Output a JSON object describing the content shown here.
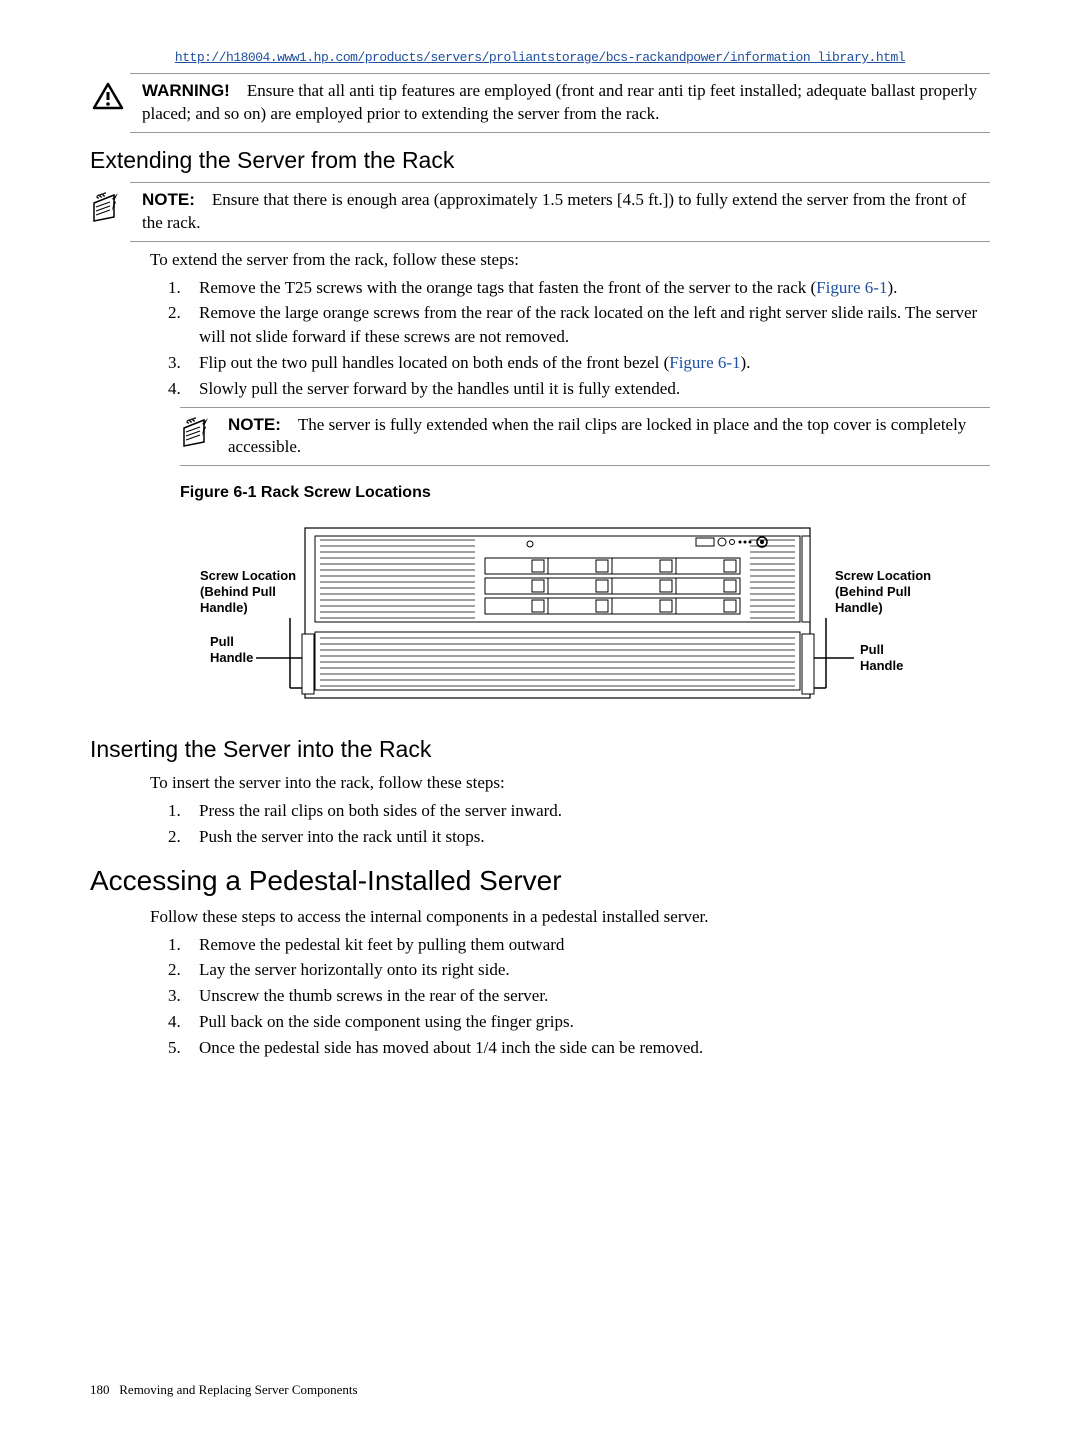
{
  "url": "http://h18004.www1.hp.com/products/servers/proliantstorage/bcs-rackandpower/information_library.html",
  "warning": {
    "label": "WARNING!",
    "text": "Ensure that all anti tip features are employed (front and rear anti tip feet installed; adequate ballast properly placed; and so on) are employed prior to extending the server from the rack."
  },
  "section1": {
    "heading": "Extending the Server from the Rack",
    "note1": {
      "label": "NOTE:",
      "text": "Ensure that there is enough area (approximately 1.5 meters [4.5 ft.]) to fully extend the server from the front of the rack."
    },
    "intro": "To extend the server from the rack, follow these steps:",
    "steps": {
      "s1_a": "Remove the T25 screws with the orange tags that fasten the front of the server to the rack (",
      "s1_link": "Figure 6-1",
      "s1_b": ").",
      "s2": "Remove the large orange screws from the rear of the rack located on the left and right server slide rails. The server will not slide forward if these screws are not removed.",
      "s3_a": "Flip out the two pull handles located on both ends of the front bezel (",
      "s3_link": "Figure 6-1",
      "s3_b": ").",
      "s4": "Slowly pull the server forward by the handles until it is fully extended."
    },
    "note2": {
      "label": "NOTE:",
      "text": "The server is fully extended when the rail clips are locked in place and the top cover is completely accessible."
    }
  },
  "figure": {
    "caption": "Figure 6-1 Rack Screw Locations",
    "label_screw_left": "Screw Location\n(Behind Pull\nHandle)",
    "label_pull_left": "Pull\nHandle",
    "label_screw_right": "Screw Location\n(Behind Pull\nHandle)",
    "label_pull_right": "Pull\nHandle"
  },
  "section2": {
    "heading": "Inserting the Server into the Rack",
    "intro": "To insert the server into the rack, follow these steps:",
    "steps": {
      "s1": "Press the rail clips on both sides of the server inward.",
      "s2": "Push the server into the rack until it stops."
    }
  },
  "section3": {
    "heading": "Accessing a Pedestal-Installed Server",
    "intro": "Follow these steps to access the internal components in a pedestal installed server.",
    "steps": {
      "s1": "Remove the pedestal kit feet by pulling them outward",
      "s2": "Lay the server horizontally onto its right side.",
      "s3": "Unscrew the thumb screws in the rear of the server.",
      "s4": "Pull back on the side component using the finger grips.",
      "s5": "Once the pedestal side has moved about 1/4 inch the side can be removed."
    }
  },
  "footer": {
    "page": "180",
    "chapter": "Removing and Replacing Server Components"
  }
}
